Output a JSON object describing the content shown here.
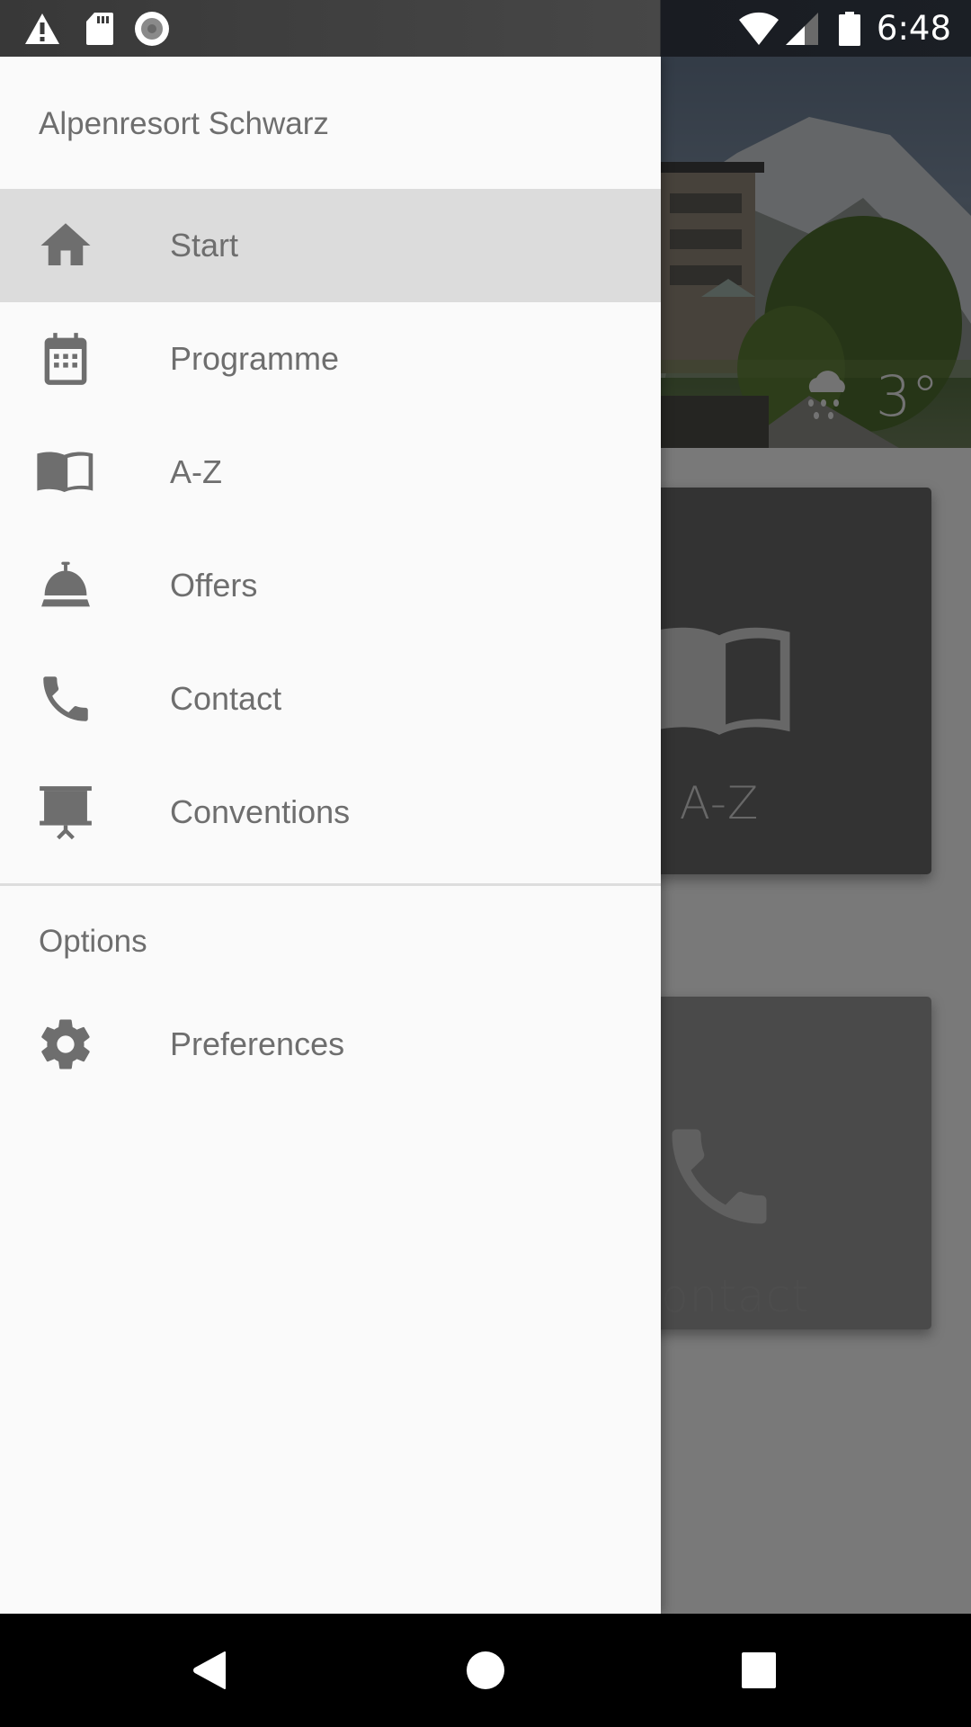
{
  "status_bar": {
    "left_icons": [
      "warning-icon",
      "sd-card-icon",
      "record-icon"
    ],
    "right_icons": [
      "wifi-icon",
      "cell-signal-icon",
      "battery-icon"
    ],
    "time": "6:48"
  },
  "drawer": {
    "title": "Alpenresort Schwarz",
    "items": [
      {
        "label": "Start",
        "icon": "home-icon",
        "active": true
      },
      {
        "label": "Programme",
        "icon": "calendar-icon",
        "active": false
      },
      {
        "label": "A-Z",
        "icon": "book-icon",
        "active": false
      },
      {
        "label": "Offers",
        "icon": "service-bell-icon",
        "active": false
      },
      {
        "label": "Contact",
        "icon": "phone-icon",
        "active": false
      },
      {
        "label": "Conventions",
        "icon": "presentation-icon",
        "active": false
      }
    ],
    "options_section": {
      "label": "Options",
      "items": [
        {
          "label": "Preferences",
          "icon": "gear-icon"
        }
      ]
    }
  },
  "background_app": {
    "weather": {
      "icon": "rain-cloud-icon",
      "temperature": "3°"
    },
    "tiles": [
      {
        "label": "A-Z",
        "icon": "book-icon"
      },
      {
        "label": "Contact",
        "icon": "phone-icon"
      }
    ]
  },
  "nav_bar": {
    "buttons": [
      "back-button",
      "home-button",
      "recents-button"
    ]
  },
  "colors": {
    "drawer_bg": "#fafafa",
    "active_item_bg": "#dcdcdc",
    "text": "#6e6e6e",
    "icon": "#6e6e6e",
    "divider": "#dddddd"
  }
}
